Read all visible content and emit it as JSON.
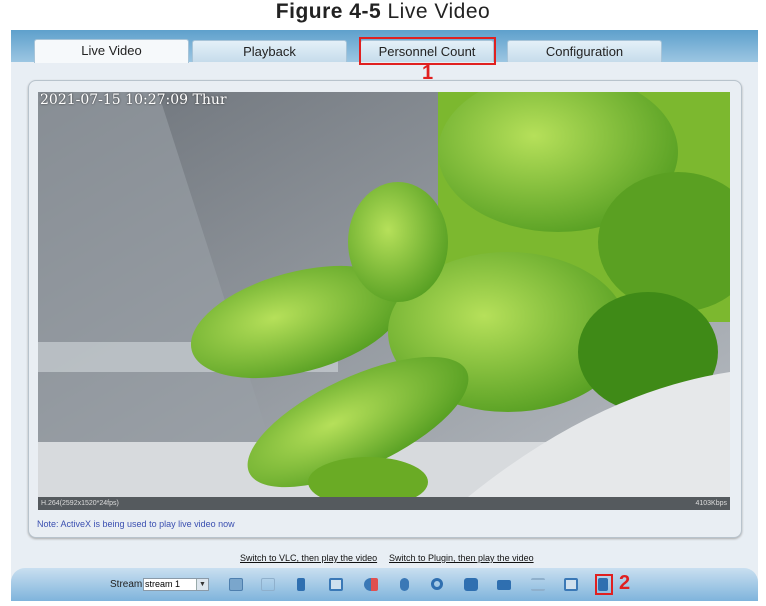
{
  "figure": {
    "label": "Figure 4-5",
    "caption": "Live Video"
  },
  "tabs": [
    {
      "label": "Live Video",
      "active": true
    },
    {
      "label": "Playback"
    },
    {
      "label": "Personnel Count"
    },
    {
      "label": "Configuration"
    }
  ],
  "callouts": [
    "1",
    "2"
  ],
  "video": {
    "timestamp": "2021-07-15 10:27:09 Thur",
    "codec_info": "H.264(2592x1520*24fps)",
    "bitrate": "4103Kbps"
  },
  "note": "Note: ActiveX is being used to play live video now",
  "links": {
    "vlc": "Switch to VLC, then play the video",
    "plugin": "Switch to Plugin, then play the video"
  },
  "toolbar": {
    "stream_label": "Stream",
    "stream_value": "stream 1",
    "icons": [
      "ptz-icon",
      "grid-icon",
      "stop-icon",
      "window-icon",
      "speaker-icon",
      "microphone-icon",
      "settings-icon",
      "snapshot-icon",
      "record-icon",
      "list-icon",
      "image-icon",
      "fullscreen-icon"
    ]
  },
  "colors": {
    "accent": "#e02020",
    "header": "#5ea0cc"
  }
}
